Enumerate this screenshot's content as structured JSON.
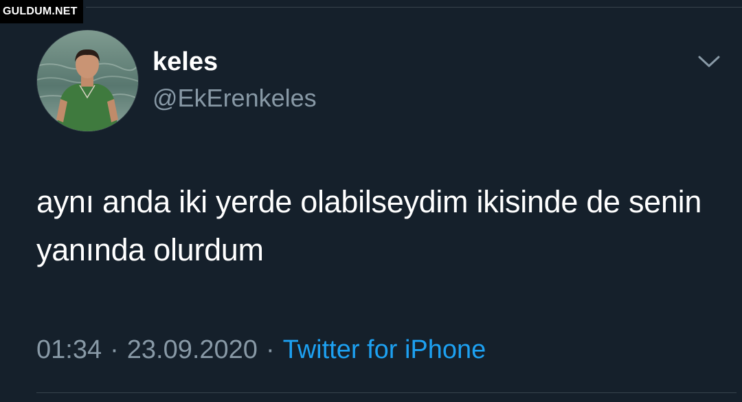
{
  "watermark": "GULDUM.NET",
  "author": {
    "display_name": "keles",
    "username": "@EkErenkeles",
    "avatar_icon": "profile-photo"
  },
  "tweet": {
    "text": "aynı anda iki yerde olabilseydim ikisinde de senin yanında olurdum",
    "time": "01:34",
    "separator": "·",
    "date": "23.09.2020",
    "source": "Twitter for iPhone"
  },
  "menu": {
    "icon": "chevron-down-icon"
  },
  "colors": {
    "background": "#15202b",
    "text": "#ffffff",
    "muted": "#8899a6",
    "link": "#1da1f2",
    "divider": "#38444d"
  }
}
